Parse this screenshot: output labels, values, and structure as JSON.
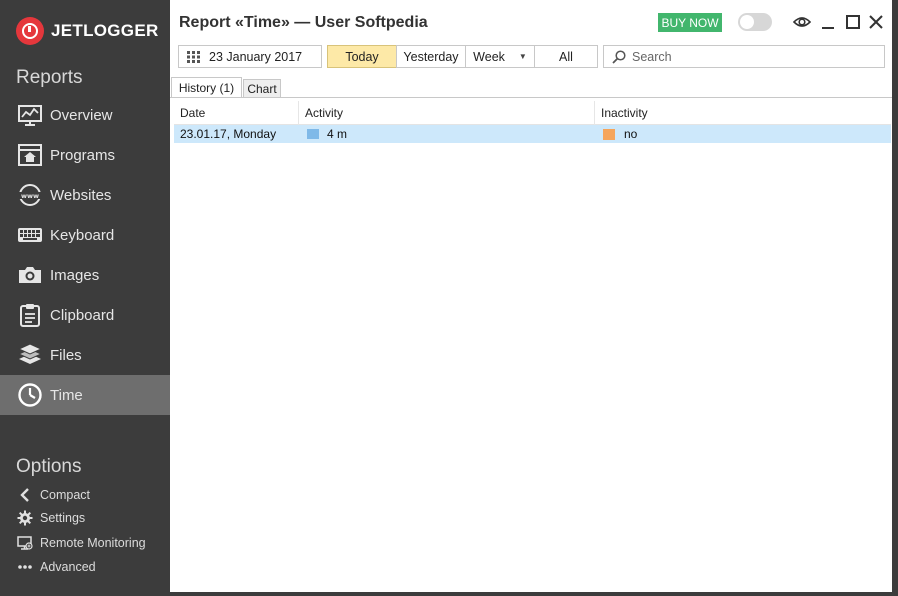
{
  "app": {
    "logo_text": "JETLOGGER"
  },
  "sidebar": {
    "reports_title": "Reports",
    "items": [
      {
        "label": "Overview",
        "icon": "overview-icon"
      },
      {
        "label": "Programs",
        "icon": "programs-icon"
      },
      {
        "label": "Websites",
        "icon": "websites-icon"
      },
      {
        "label": "Keyboard",
        "icon": "keyboard-icon"
      },
      {
        "label": "Images",
        "icon": "camera-icon"
      },
      {
        "label": "Clipboard",
        "icon": "clipboard-icon"
      },
      {
        "label": "Files",
        "icon": "files-icon"
      },
      {
        "label": "Time",
        "icon": "clock-icon",
        "active": true
      }
    ],
    "options_title": "Options",
    "options": [
      {
        "label": "Compact",
        "icon": "chevron-left-icon"
      },
      {
        "label": "Settings",
        "icon": "gear-icon"
      },
      {
        "label": "Remote Monitoring",
        "icon": "remote-monitoring-icon"
      },
      {
        "label": "Advanced",
        "icon": "more-dots-icon"
      }
    ]
  },
  "header": {
    "title": "Report «Time» — User Softpedia",
    "buy_label": "BUY NOW"
  },
  "toolbar": {
    "date": "23 January 2017",
    "ranges": [
      "Today",
      "Yesterday",
      "Week",
      "All"
    ],
    "active_range": "Today",
    "search_placeholder": "Search"
  },
  "tabs": [
    "History (1)",
    "Chart"
  ],
  "table": {
    "columns": [
      "Date",
      "Activity",
      "Inactivity"
    ],
    "rows": [
      {
        "date": "23.01.17, Monday",
        "activity": "4 m",
        "inactivity": "no"
      }
    ]
  },
  "colors": {
    "accent_buy": "#42b66d",
    "active_range": "#fde9a7",
    "row_selected": "#cde8fb",
    "activity_bar": "#7fb9e8",
    "inactivity_bar": "#f5a55c"
  }
}
